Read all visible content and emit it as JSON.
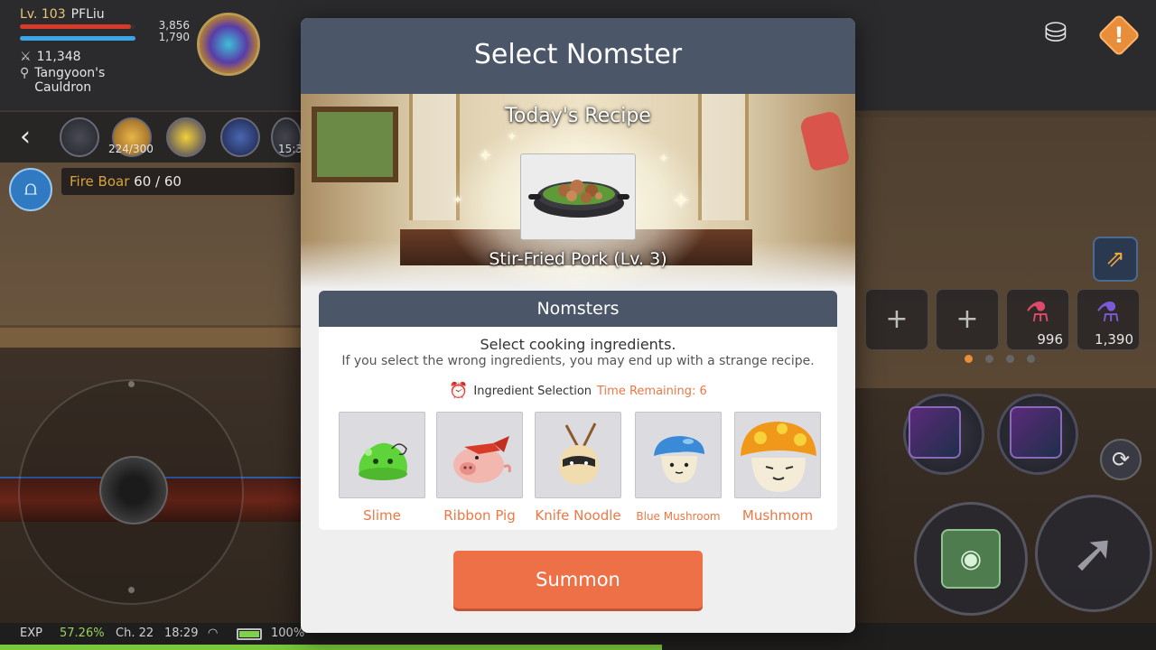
{
  "hud": {
    "level": "Lv. 103",
    "name": "PFLiu",
    "hp": "3,856",
    "mp": "1,790",
    "power": "11,348",
    "location": "Tangyoon's Cauldron",
    "quest_counter": "224/300",
    "timer_partial": "15:3",
    "quest_name": "Fire Boar",
    "quest_count": "60 / 60"
  },
  "slots": {
    "plus1": "+",
    "plus2": "+",
    "potion1_count": "996",
    "potion2_count": "1,390"
  },
  "status": {
    "exp_label": "EXP",
    "exp_percent": "57.26%",
    "exp_fraction": 0.5726,
    "channel": "Ch. 22",
    "time": "18:29",
    "battery": "100%"
  },
  "modal": {
    "title": "Select Nomster",
    "recipe_heading": "Today's Recipe",
    "recipe_name": "Stir-Fried Pork (Lv. 3)",
    "panel_title": "Nomsters",
    "instruction": "Select cooking ingredients.",
    "warning": "If you select the wrong ingredients, you may end up with a strange recipe.",
    "timer_label": "Ingredient Selection",
    "timer_remaining": "Time Remaining: 6",
    "summon_label": "Summon",
    "ingredients": [
      {
        "label": "Slime"
      },
      {
        "label": "Ribbon Pig"
      },
      {
        "label": "Knife Noodle"
      },
      {
        "label": "Blue Mushroom"
      },
      {
        "label": "Mushmom"
      }
    ]
  },
  "colors": {
    "accent": "#ee7046",
    "header": "#4b5669",
    "label_orange": "#ee7744"
  }
}
